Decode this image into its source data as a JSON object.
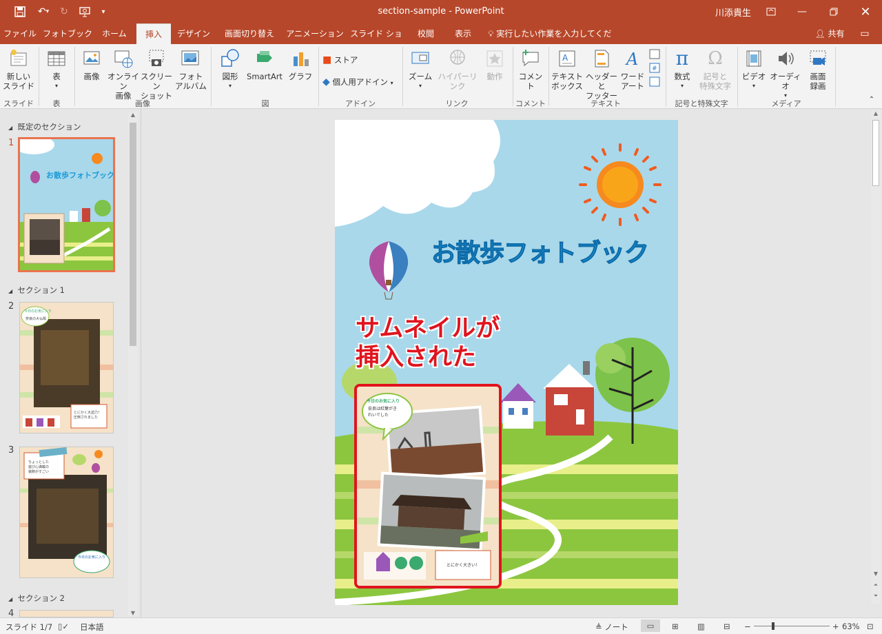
{
  "window": {
    "title": "section-sample  -  PowerPoint",
    "user": "川添貴生"
  },
  "tabs": [
    {
      "label": "ファイル"
    },
    {
      "label": "フォトブック"
    },
    {
      "label": "ホーム"
    },
    {
      "label": "挿入"
    },
    {
      "label": "デザイン"
    },
    {
      "label": "画面切り替え"
    },
    {
      "label": "アニメーション"
    },
    {
      "label": "スライド ショー"
    },
    {
      "label": "校閲"
    },
    {
      "label": "表示"
    }
  ],
  "tell_me": "実行したい作業を入力してください",
  "share": "共有",
  "ribbon": {
    "new_slide": "新しい\nスライド",
    "table": "表",
    "image": "画像",
    "online_image": "オンライン\n画像",
    "screenshot": "スクリーン\nショット",
    "photo_album": "フォト\nアルバム",
    "shapes": "図形",
    "smartart": "SmartArt",
    "graph": "グラフ",
    "store": "ストア",
    "personal_addin": "個人用アドイン",
    "zoom": "ズーム",
    "hyperlink": "ハイパーリンク",
    "action": "動作",
    "comment": "コメント",
    "textbox": "テキスト\nボックス",
    "header_footer": "ヘッダーと\nフッター",
    "wordart": "ワード\nアート",
    "equation": "数式",
    "symbol": "記号と\n特殊文字",
    "video": "ビデオ",
    "audio": "オーディオ",
    "screen_record": "画面\n録画",
    "groups": {
      "slide": "スライド",
      "table": "表",
      "image": "画像",
      "figure": "図",
      "addin": "アドイン",
      "link": "リンク",
      "comment": "コメント",
      "text": "テキスト",
      "symbols": "記号と特殊文字",
      "media": "メディア"
    }
  },
  "panel": {
    "sections": [
      {
        "label": "既定のセクション"
      },
      {
        "label": "セクション 1"
      },
      {
        "label": "セクション 2"
      }
    ],
    "slide_numbers": [
      "1",
      "2",
      "3",
      "4"
    ],
    "thumb1_title": "お散歩フォトブック",
    "thumb2_bubble": "今日のお気に入り",
    "thumb2_bubble_sub": "奈良の大仏殿",
    "thumb2_note": "とにかく大迫力！\n圧倒されました",
    "thumb3_note": "ちょっとした\n遊び心満載の\n装飾がすごい",
    "thumb3_bubble": "今日のお気に入り"
  },
  "slide": {
    "title": "お散歩フォトブック",
    "annotation_line1": "サムネイルが",
    "annotation_line2": "挿入された",
    "inner_bubble_title": "今日のお気に入り",
    "inner_bubble_text": "奈良は紅葉がき\nれいでした",
    "inner_note": "とにかく大きい！"
  },
  "status": {
    "slide_info": "スライド 1/7",
    "language": "日本語",
    "notes": "ノート",
    "zoom": "63%"
  },
  "colors": {
    "accent": "#b7472a",
    "title_blue": "#1a9ad8",
    "annotation_red": "#e0141e",
    "sky": "#a9d8ea",
    "grass": "#8cc63f",
    "selected_thumb": "#e9734f"
  }
}
